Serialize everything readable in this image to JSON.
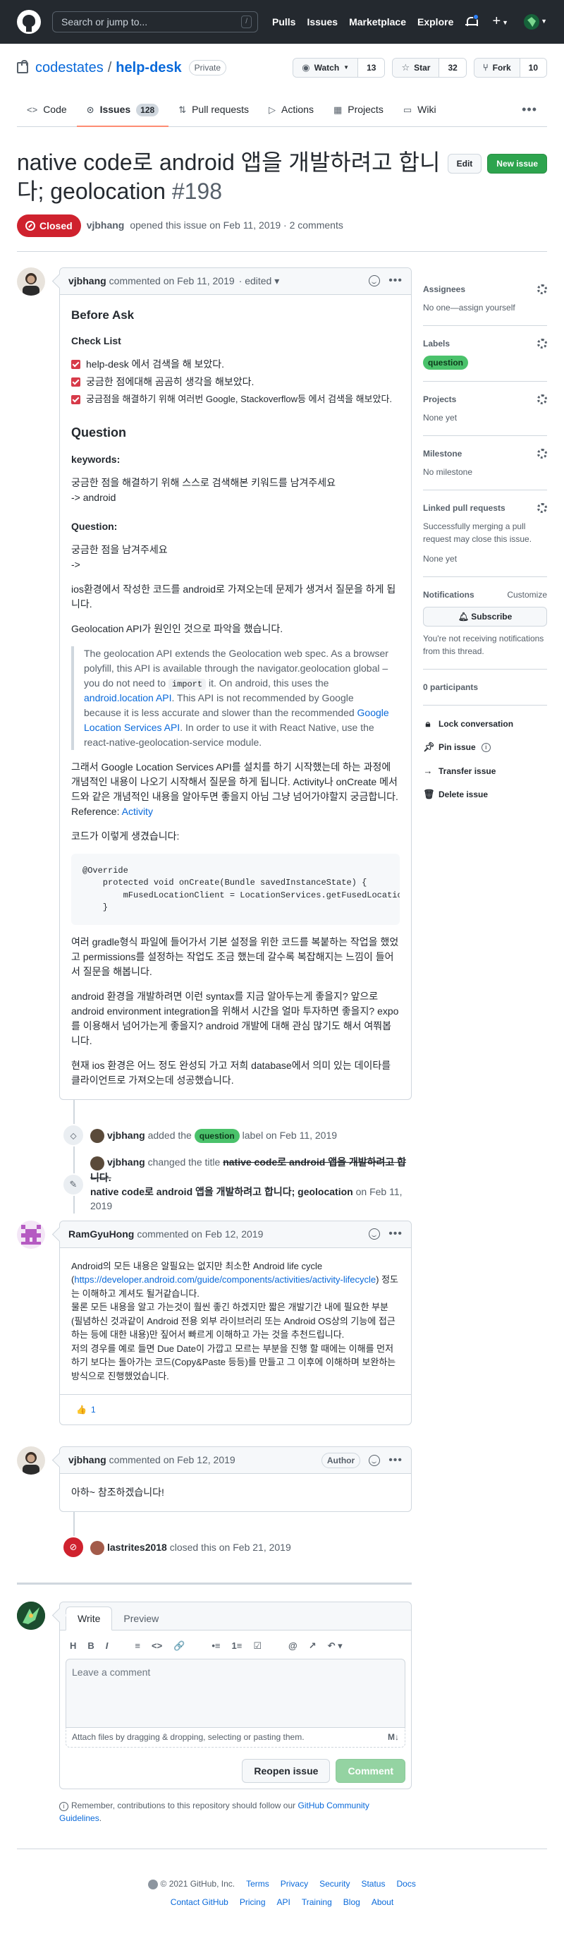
{
  "header": {
    "search_placeholder": "Search or jump to...",
    "search_shortcut": "/",
    "nav": [
      "Pulls",
      "Issues",
      "Marketplace",
      "Explore"
    ]
  },
  "repo": {
    "owner": "codestates",
    "name": "help-desk",
    "visibility": "Private",
    "watch_label": "Watch",
    "watch_count": "13",
    "star_label": "Star",
    "star_count": "32",
    "fork_label": "Fork",
    "fork_count": "10"
  },
  "tabs": [
    {
      "label": "Code",
      "icon": "code-icon"
    },
    {
      "label": "Issues",
      "count": "128",
      "icon": "issue-icon",
      "active": true
    },
    {
      "label": "Pull requests",
      "icon": "pull-request-icon"
    },
    {
      "label": "Actions",
      "icon": "play-icon"
    },
    {
      "label": "Projects",
      "icon": "table-icon"
    },
    {
      "label": "Wiki",
      "icon": "book-icon"
    }
  ],
  "issue": {
    "title": "native code로 android 앱을 개발하려고 합니다; geolocation",
    "number": "#198",
    "edit_label": "Edit",
    "new_issue_label": "New issue",
    "state": "Closed",
    "author": "vjbhang",
    "opened_text": "opened this issue on Feb 11, 2019 · 2 comments"
  },
  "comments": {
    "first": {
      "author": "vjbhang",
      "meta": "commented on Feb 11, 2019",
      "edited": "· edited ▾",
      "h_before": "Before Ask",
      "h_checklist": "Check List",
      "checks": [
        "help-desk 에서 검색을 해 보았다.",
        "궁금한 점에대해 곰곰히 생각을 해보았다.",
        "궁금점을 해결하기 위해 여러번 Google, Stackoverflow등 에서 검색을 해보았다."
      ],
      "h_question": "Question",
      "h_keywords": "keywords:",
      "keywords_1": "궁금한 점을 해결하기 위해 스스로 검색해본 키워드를 남겨주세요",
      "keywords_2": "-> android",
      "h_question2": "Question:",
      "question_1": "궁금한 점을 남겨주세요",
      "question_2": "->",
      "p1": "ios환경에서 작성한 코드를 android로 가져오는데 문제가 생겨서 질문을 하게 됩니다.",
      "p2": "Geolocation API가 원인인 것으로 파악을 했습니다.",
      "quote_a": "The geolocation API extends the Geolocation web spec. As a browser polyfill, this API is available through the navigator.geolocation global – you do not need to ",
      "quote_code": "import",
      "quote_b": " it. On android, this uses the ",
      "quote_link1": "android.location API",
      "quote_c": ". This API is not recommended by Google because it is less accurate and slower than the recommended ",
      "quote_link2": "Google Location Services API",
      "quote_d": ". In order to use it with React Native, use the react-native-geolocation-service module.",
      "p3": "그래서 Google Location Services API를 설치를 하기 시작했는데 하는 과정에 개념적인 내용이 나오기 시작해서 질문을 하게 됩니다. Activity나 onCreate 메서드와 같은 개념적인 내용을 알아두면 좋을지 아님 그냥 넘어가야할지 궁금합니다. Reference: ",
      "p3_link": "Activity",
      "p4": "코드가 이렇게 생겼습니다:",
      "code": "@Override\n    protected void onCreate(Bundle savedInstanceState) {\n        mFusedLocationClient = LocationServices.getFusedLocationProviderClient(this);\n    }",
      "p5": "여러 gradle형식 파일에 들어가서 기본 설정을 위한 코드를 복붙하는 작업을 했었고 permissions를 설정하는 작업도 조금 했는데 갈수록 복잡해지는 느낌이 들어서 질문을 해봅니다.",
      "p6": "android 환경을 개발하려면 이런 syntax를 지금 알아두는게 좋을지? 앞으로 android environment integration을 위해서 시간을 얼마 투자하면 좋을지? expo를 이용해서 넘어가는게 좋을지? android 개발에 대해 관심 많기도 해서 여쭤봅니다.",
      "p7": "현재 ios 환경은 어느 정도 완성되 가고 저희 database에서 의미 있는 데이타를 클라이언트로 가져오는데 성공했습니다."
    },
    "event_label": {
      "author": "vjbhang",
      "pre": "added the",
      "label": "question",
      "post": "label on Feb 11, 2019"
    },
    "event_title": {
      "author": "vjbhang",
      "pre": "changed the title",
      "old": "native code로 android 앱을 개발하려고 합니다.",
      "new": "native code로 android 앱을 개발하려고 합니다; geolocation",
      "post": "on Feb 11, 2019"
    },
    "second": {
      "author": "RamGyuHong",
      "meta": "commented on Feb 12, 2019",
      "t1": "Android의 모든 내용은 알필요는 없지만 최소한 Android life cycle (",
      "t1_link": "https://developer.android.com/guide/components/activities/activity-lifecycle",
      "t2": ") 정도는 이해하고 계셔도 될거같습니다.",
      "t3": "물론 모든 내용을 알고 가는것이 훨씬 좋긴 하겠지만 짧은 개발기간 내에 필요한 부분(필념하신 것과같이 Android 전용 외부 라이브러리 또는 Android OS상의 기능에 접근하는 등에 대한 내용)만 짚어서 빠르게 이해하고 가는 것을 추천드립니다.",
      "t4": "저의 경우를 예로 들면 Due Date이 가깝고 모르는 부분을 진행 할 때에는 이해를 먼저 하기 보다는 돌아가는 코드(Copy&Paste 등등)를 만들고 그 이후에 이해하며 보완하는 방식으로 진행했었습니다.",
      "reaction_emoji": "👍",
      "reaction_count": "1"
    },
    "third": {
      "author": "vjbhang",
      "meta": "commented on Feb 12, 2019",
      "badge": "Author",
      "text": "아하~ 참조하겠습니다!"
    },
    "event_closed": {
      "author": "lastrites2018",
      "text": "closed this on Feb 21, 2019"
    }
  },
  "new_comment": {
    "tab_write": "Write",
    "tab_preview": "Preview",
    "toolbar": [
      "H",
      "B",
      "I",
      "≡",
      "<>",
      "🔗",
      "•≡",
      "1≡",
      "☑",
      "@",
      "↗",
      "↶ ▾"
    ],
    "placeholder": "Leave a comment",
    "attach": "Attach files by dragging & dropping, selecting or pasting them.",
    "reopen_label": "Reopen issue",
    "comment_label": "Comment",
    "contrib_pre": "Remember, contributions to this repository should follow our ",
    "contrib_link": "GitHub Community Guidelines",
    "contrib_post": "."
  },
  "sidebar": {
    "assignees_title": "Assignees",
    "assignees_value": "No one—assign yourself",
    "labels_title": "Labels",
    "labels_value": "question",
    "projects_title": "Projects",
    "projects_value": "None yet",
    "milestone_title": "Milestone",
    "milestone_value": "No milestone",
    "linked_title": "Linked pull requests",
    "linked_desc": "Successfully merging a pull request may close this issue.",
    "linked_value": "None yet",
    "notif_title": "Notifications",
    "notif_customize": "Customize",
    "subscribe_label": "Subscribe",
    "notif_desc": "You're not receiving notifications from this thread.",
    "participants": "0 participants",
    "actions": [
      {
        "label": "Lock conversation",
        "icon": "lock-icon"
      },
      {
        "label": "Pin issue",
        "icon": "pin-icon"
      },
      {
        "label": "Transfer issue",
        "icon": "arrow-right-icon"
      },
      {
        "label": "Delete issue",
        "icon": "trash-icon"
      }
    ]
  },
  "footer": {
    "copyright": "© 2021 GitHub, Inc.",
    "row1": [
      "Terms",
      "Privacy",
      "Security",
      "Status",
      "Docs"
    ],
    "row2": [
      "Contact GitHub",
      "Pricing",
      "API",
      "Training",
      "Blog",
      "About"
    ]
  },
  "colors": {
    "header_bg": "#24292f",
    "closed_red": "#cf222e",
    "green": "#2da44e",
    "label_question": "#4ac26b",
    "link": "#0969da"
  }
}
